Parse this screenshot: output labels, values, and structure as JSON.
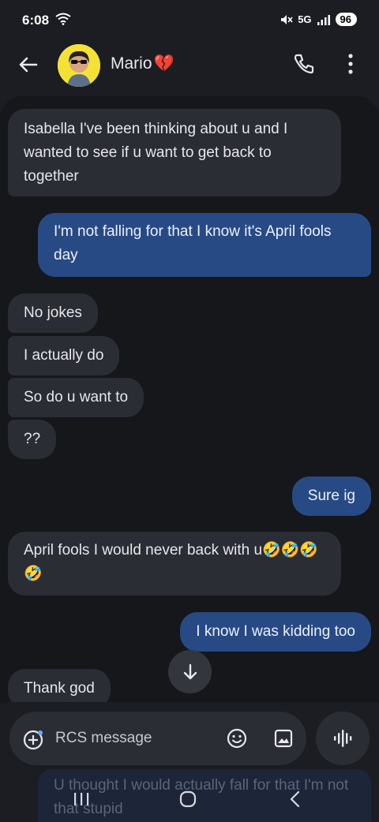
{
  "status_bar": {
    "time": "6:08",
    "network": "5G",
    "battery": "96"
  },
  "header": {
    "contact_name": "Mario",
    "name_emoji": "💔"
  },
  "messages": [
    {
      "direction": "incoming",
      "text": "Isabella I've been  thinking  about  u and I wanted to see if u want to get back to together"
    },
    {
      "direction": "outgoing",
      "text": "I'm not falling for that I know it's April fools day"
    },
    {
      "direction": "incoming",
      "text": "No jokes"
    },
    {
      "direction": "incoming",
      "text": "I actually do"
    },
    {
      "direction": "incoming",
      "text": "So do u want to"
    },
    {
      "direction": "incoming",
      "text": "??"
    },
    {
      "direction": "outgoing",
      "text": "Sure ig"
    },
    {
      "direction": "incoming",
      "text": "April fools I would never back with u🤣🤣🤣🤣"
    },
    {
      "direction": "outgoing",
      "text": "I know I was kidding too"
    },
    {
      "direction": "incoming",
      "text": "Thank god"
    }
  ],
  "obscured_message": "U thought I would actually fall for that I'm not that stupid",
  "composer": {
    "placeholder": "RCS message"
  },
  "icons": {
    "back": "arrow-left-icon",
    "call": "phone-icon",
    "more": "more-vert-icon",
    "scroll_down": "arrow-down-icon",
    "add": "add-circle-icon",
    "emoji": "emoji-icon",
    "gallery": "gallery-icon",
    "voice": "voice-waveform-icon"
  },
  "colors": {
    "incoming_bubble": "#2a2d33",
    "outgoing_bubble": "#284a84",
    "background": "#15171b"
  }
}
